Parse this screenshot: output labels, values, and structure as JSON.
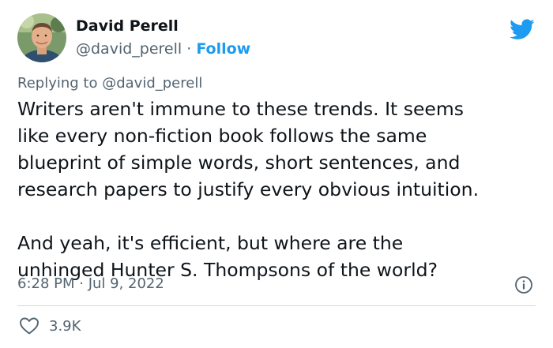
{
  "author": {
    "name": "David Perell",
    "handle": "@david_perell",
    "separator": "·",
    "follow_label": "Follow"
  },
  "reply": {
    "prefix": "Replying to",
    "handle": "@david_perell"
  },
  "tweet": {
    "paragraph_1": "Writers aren't immune to these trends. It seems\nlike every non-fiction book follows the same\nblueprint of simple words, short sentences, and\nresearch papers to justify every obvious intuition.",
    "paragraph_2": "And yeah, it's efficient, but where are the\nunhinged Hunter S. Thompsons of the world?",
    "timestamp": "6:28 PM · Jul 9, 2022"
  },
  "engagement": {
    "likes": "3.9K"
  },
  "icons": {
    "brand": "twitter-bird-icon",
    "info": "info-icon",
    "like": "heart-icon"
  },
  "colors": {
    "accent": "#1d9bf0",
    "text": "#0f1419",
    "secondary": "#536471",
    "divider": "#cfd9de"
  }
}
